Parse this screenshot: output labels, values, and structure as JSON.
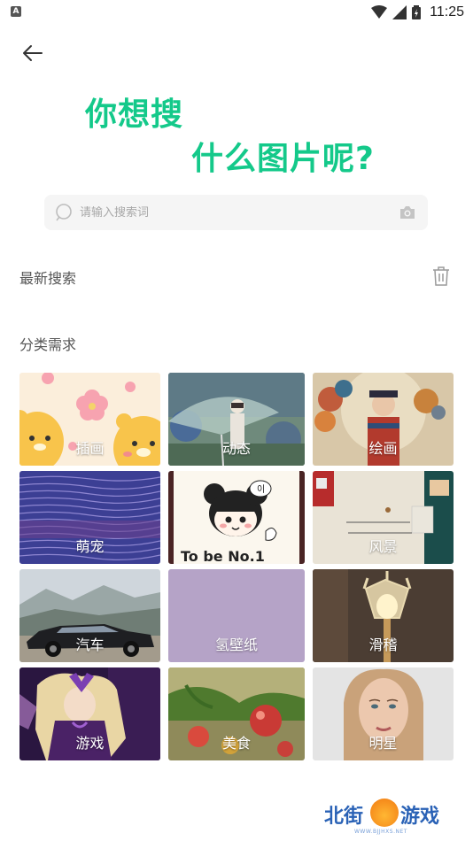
{
  "status_bar": {
    "time": "11:25",
    "app_badge": "A"
  },
  "headline": {
    "line1": "你想搜",
    "line2": "什么图片呢?"
  },
  "search": {
    "placeholder": "请输入搜索词"
  },
  "recent_title": "最新搜索",
  "category_title": "分类需求",
  "categories": [
    {
      "label": "插画"
    },
    {
      "label": "动态"
    },
    {
      "label": "绘画"
    },
    {
      "label": "萌宠"
    },
    {
      "label": ""
    },
    {
      "label": "风景"
    },
    {
      "label": "汽车"
    },
    {
      "label": "氢壁纸"
    },
    {
      "label": "滑稽"
    },
    {
      "label": "游戏"
    },
    {
      "label": "美食"
    },
    {
      "label": "明星"
    }
  ],
  "tile_text": {
    "tobe": "To be No.1",
    "bubble": "이"
  },
  "watermark": {
    "brand_left": "北街",
    "brand_right": "游戏",
    "url": "WWW.BJJHXS.NET"
  },
  "colors": {
    "accent": "#14c98a",
    "text_gray": "#555555",
    "placeholder": "#a8a8a8"
  }
}
